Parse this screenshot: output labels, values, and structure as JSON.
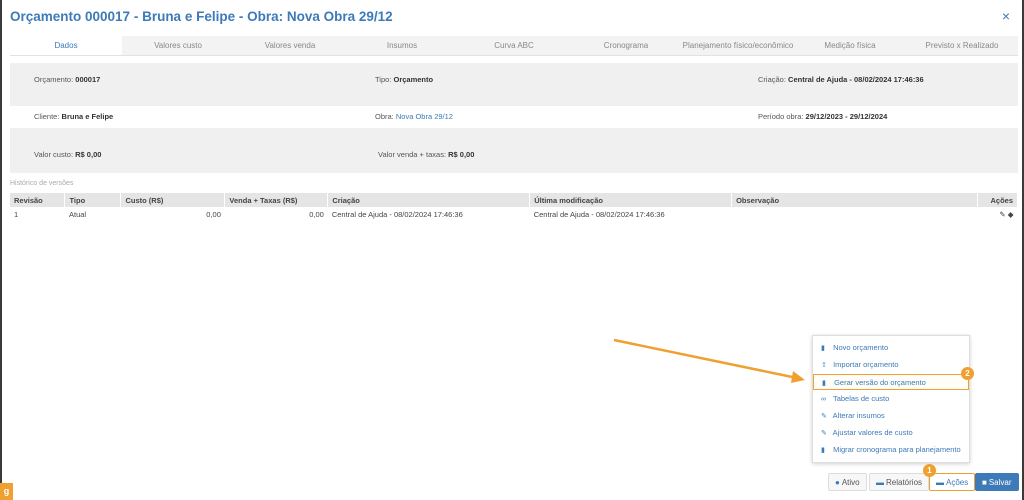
{
  "window": {
    "title": "Orçamento 000017 - Bruna e Felipe - Obra: Nova Obra 29/12",
    "close_glyph": "×"
  },
  "tabs": [
    {
      "label": "Dados",
      "active": true
    },
    {
      "label": "Valores custo",
      "active": false
    },
    {
      "label": "Valores venda",
      "active": false
    },
    {
      "label": "Insumos",
      "active": false
    },
    {
      "label": "Curva ABC",
      "active": false
    },
    {
      "label": "Cronograma",
      "active": false
    },
    {
      "label": "Planejamento físico/econômico",
      "active": false
    },
    {
      "label": "Medição física",
      "active": false
    },
    {
      "label": "Previsto x Realizado",
      "active": false
    }
  ],
  "info": {
    "orcamento_label": "Orçamento:",
    "orcamento_value": "000017",
    "tipo_label": "Tipo:",
    "tipo_value": "Orçamento",
    "criacao_label": "Criação:",
    "criacao_value": "Central de Ajuda - 08/02/2024 17:46:36",
    "cliente_label": "Cliente:",
    "cliente_value": "Bruna e Felipe",
    "obra_label": "Obra:",
    "obra_value": "Nova Obra 29/12",
    "periodo_label": "Período obra:",
    "periodo_value": "29/12/2023 - 29/12/2024",
    "valor_custo_label": "Valor custo:",
    "valor_custo_value": "R$ 0,00",
    "valor_venda_label": "Valor venda + taxas:",
    "valor_venda_value": "R$ 0,00"
  },
  "history": {
    "section_label": "Histórico de versões",
    "headers": [
      "Revisão",
      "Tipo",
      "Custo (R$)",
      "Venda + Taxas (R$)",
      "Criação",
      "Última modificação",
      "Observação",
      "Ações"
    ],
    "rows": [
      {
        "revisao": "1",
        "tipo": "Atual",
        "custo": "0,00",
        "venda": "0,00",
        "criacao": "Central de Ajuda - 08/02/2024 17:46:36",
        "modificacao": "Central de Ajuda - 08/02/2024 17:46:36",
        "observacao": ""
      }
    ]
  },
  "actions_menu": {
    "items": [
      {
        "label": "Novo orçamento",
        "icon": "file-icon"
      },
      {
        "label": "Importar orçamento",
        "icon": "upload-icon"
      },
      {
        "label": "Gerar versão do orçamento",
        "icon": "file-icon",
        "highlighted": true
      },
      {
        "label": "Tabelas de custo",
        "icon": "link-icon"
      },
      {
        "label": "Alterar insumos",
        "icon": "pencil-icon"
      },
      {
        "label": "Ajustar valores de custo",
        "icon": "pencil-icon"
      },
      {
        "label": "Migrar cronograma para planejamento",
        "icon": "file-icon"
      }
    ]
  },
  "footer": {
    "ativo_label": "Ativo",
    "relatorios_label": "Relatórios",
    "acoes_label": "Ações",
    "salvar_label": "Salvar"
  },
  "annotations": {
    "badge_1": "1",
    "badge_2": "2",
    "accent_color": "#f0a030"
  },
  "colors": {
    "primary": "#3d7ab8",
    "highlight": "#f0a030"
  }
}
